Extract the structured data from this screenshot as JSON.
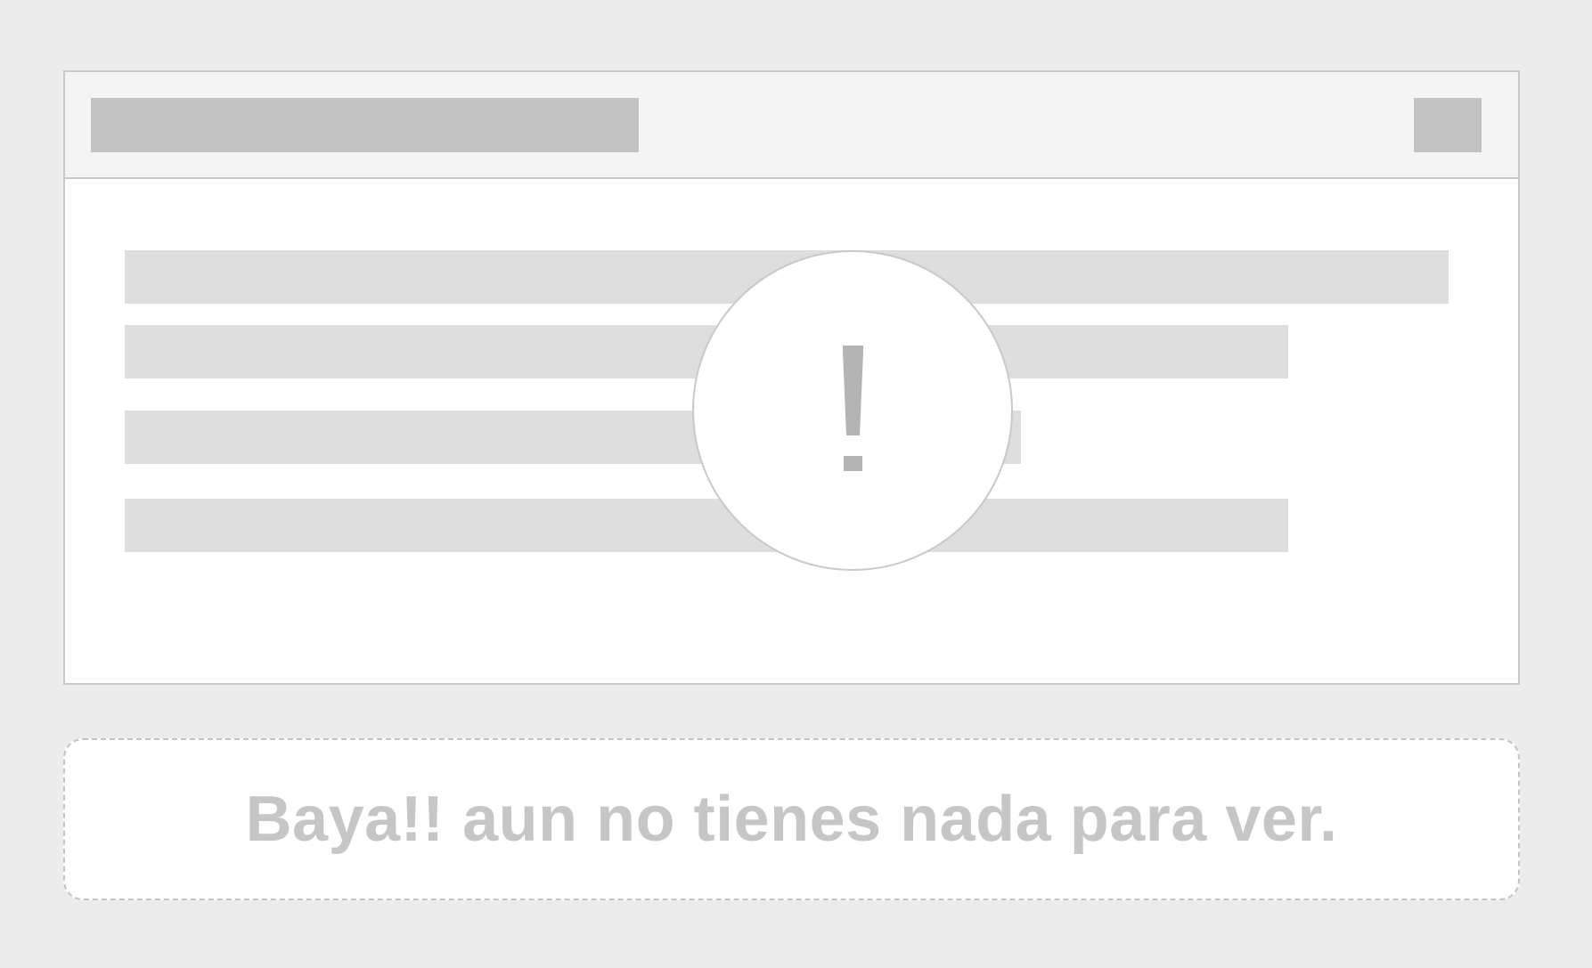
{
  "empty_state": {
    "icon": "exclamation-icon",
    "message": "Baya!! aun no tienes nada para ver."
  },
  "colors": {
    "background": "#ececec",
    "panel": "#ffffff",
    "header": "#f4f4f4",
    "placeholder_dark": "#c2c2c2",
    "placeholder_light": "#dedede",
    "border": "#c9c9c9",
    "icon": "#b4b4b4",
    "message_text": "#c6c6c6"
  }
}
